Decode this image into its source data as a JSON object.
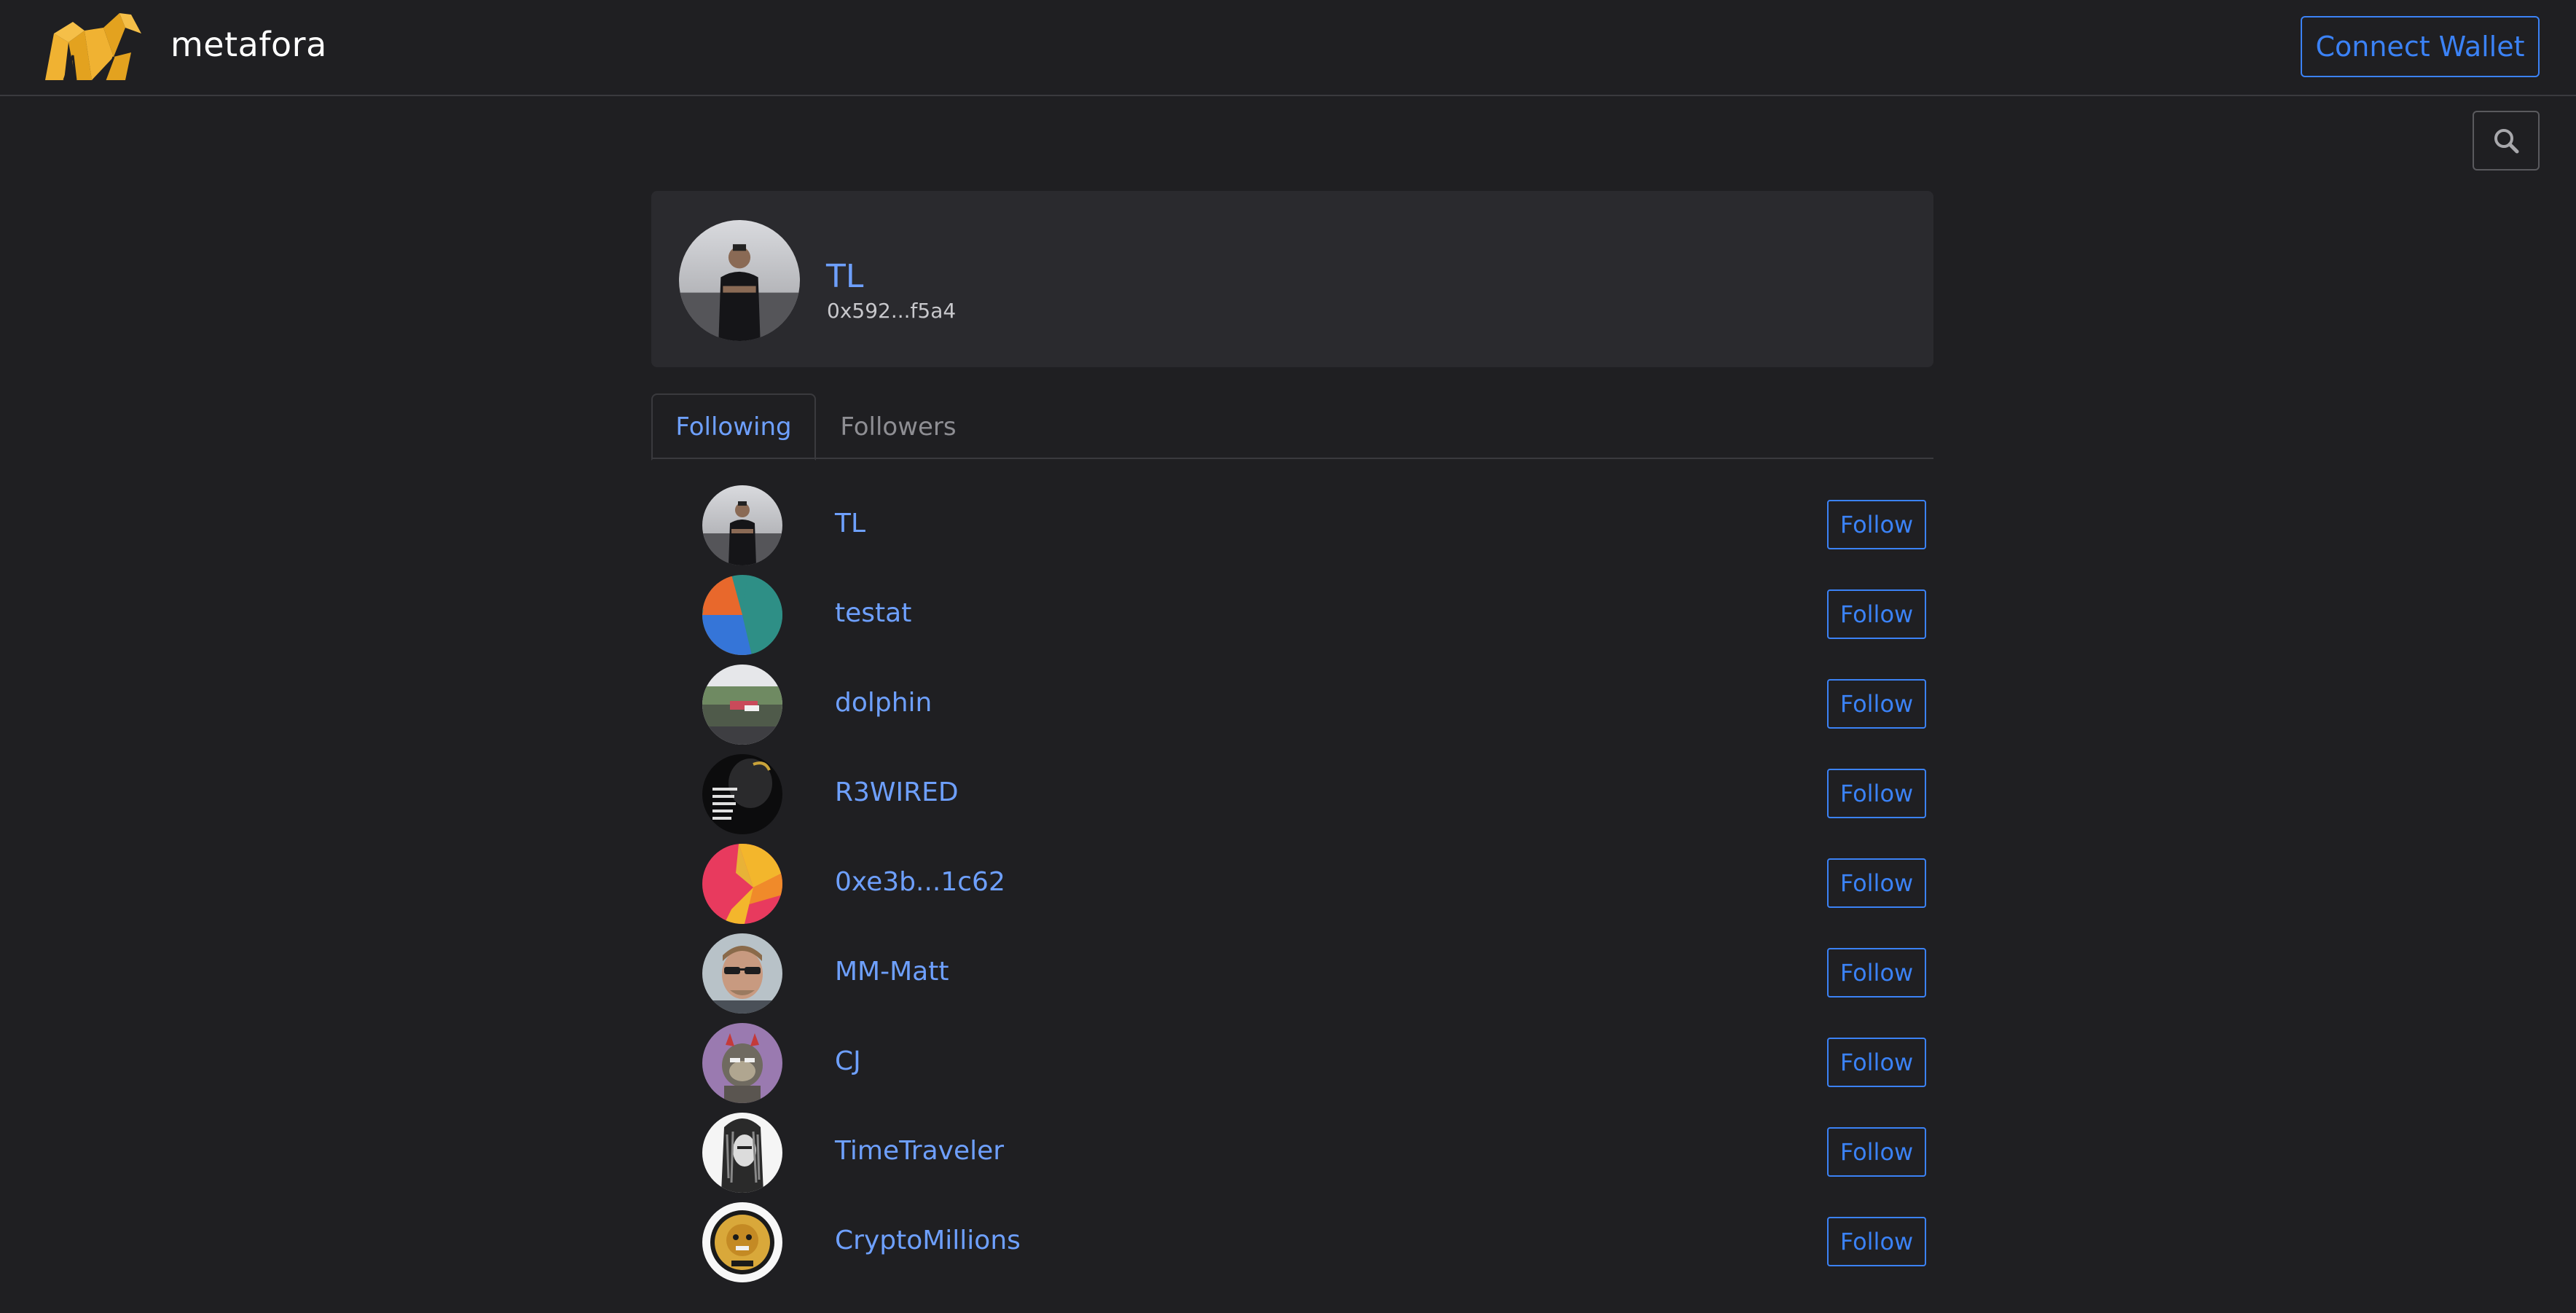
{
  "header": {
    "brand": "metafora",
    "connect_label": "Connect Wallet",
    "logo_icon": "metafora-bull-logo",
    "search_icon": "search-icon"
  },
  "profile": {
    "name": "TL",
    "address": "0x592...f5a4"
  },
  "tabs": [
    {
      "label": "Following",
      "active": true
    },
    {
      "label": "Followers",
      "active": false
    }
  ],
  "following": [
    {
      "name": "TL",
      "button": "Follow",
      "avatar": "photo-man-black-shirt"
    },
    {
      "name": "testat",
      "button": "Follow",
      "avatar": "pie-orange-blue-teal"
    },
    {
      "name": "dolphin",
      "button": "Follow",
      "avatar": "photo-landscape"
    },
    {
      "name": "R3WIRED",
      "button": "Follow",
      "avatar": "dark-quote-image"
    },
    {
      "name": "0xe3b...1c62",
      "button": "Follow",
      "avatar": "geometric-red-yellow"
    },
    {
      "name": "MM-Matt",
      "button": "Follow",
      "avatar": "photo-man-sunglasses"
    },
    {
      "name": "CJ",
      "button": "Follow",
      "avatar": "cartoon-ape-purple"
    },
    {
      "name": "TimeTraveler",
      "button": "Follow",
      "avatar": "sketch-portrait"
    },
    {
      "name": "CryptoMillions",
      "button": "Follow",
      "avatar": "gold-lion-badge"
    }
  ],
  "colors": {
    "background": "#1f1f22",
    "card": "#2a2a2e",
    "accent": "#3b82f6",
    "link": "#6ea0ff",
    "logo": "#f0b232"
  }
}
